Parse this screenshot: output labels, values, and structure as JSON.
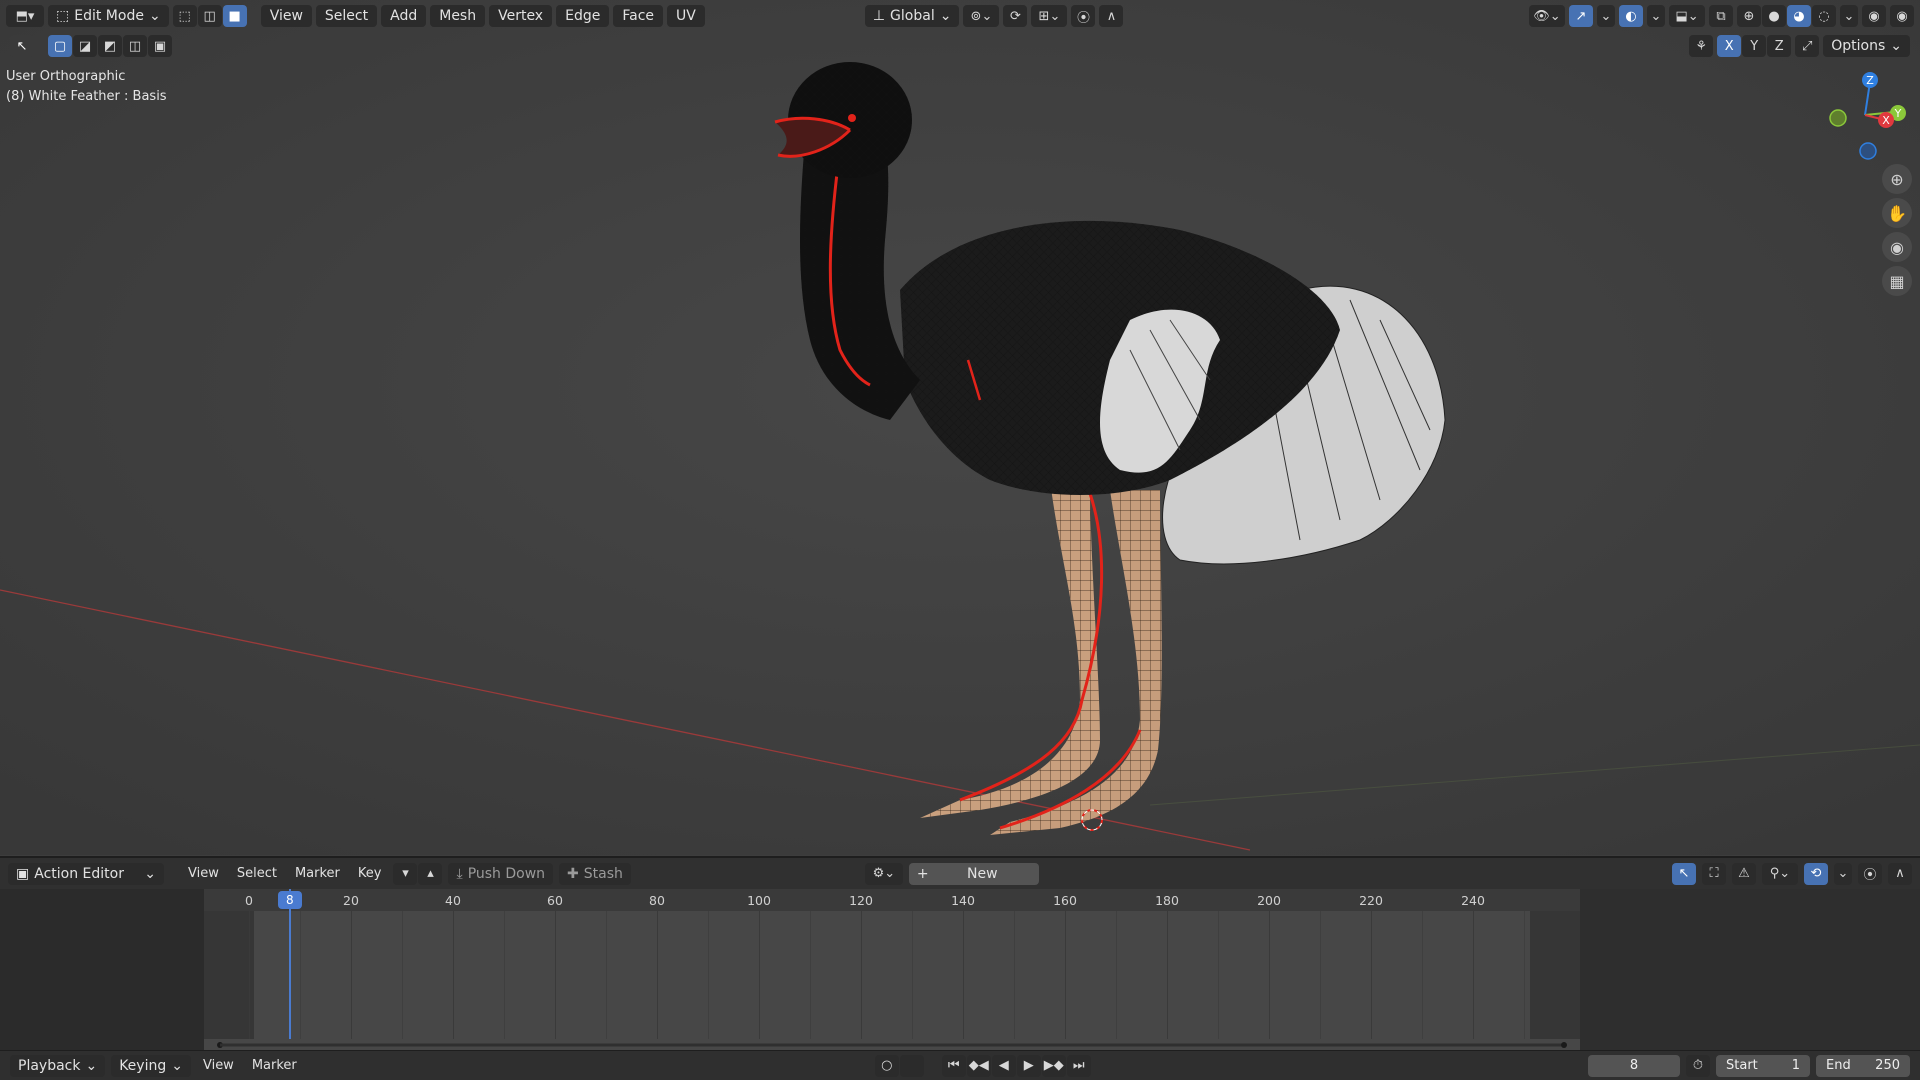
{
  "header": {
    "editor_icon": "3d-viewport-icon",
    "mode": "Edit Mode",
    "menus": [
      "View",
      "Select",
      "Add",
      "Mesh",
      "Vertex",
      "Edge",
      "Face",
      "UV"
    ],
    "orientation": "Global",
    "axes": [
      "X",
      "Y",
      "Z"
    ],
    "options_label": "Options"
  },
  "viewport": {
    "view_name": "User Orthographic",
    "object_info": "(8) White Feather : Basis",
    "gizmo": {
      "z": "Z",
      "y": "Y",
      "x": "X"
    }
  },
  "action_editor": {
    "editor_label": "Action Editor",
    "menus": [
      "View",
      "Select",
      "Marker",
      "Key"
    ],
    "push_down_label": "Push Down",
    "stash_label": "Stash",
    "new_label": "New",
    "ruler_ticks": [
      "0",
      "20",
      "40",
      "60",
      "80",
      "100",
      "120",
      "140",
      "160",
      "180",
      "200",
      "220",
      "240"
    ],
    "current_frame_badge": "8"
  },
  "playback": {
    "playback_label": "Playback",
    "keying_label": "Keying",
    "view_label": "View",
    "marker_label": "Marker",
    "current_frame": "8",
    "start_label": "Start",
    "start_value": "1",
    "end_label": "End",
    "end_value": "250"
  },
  "colors": {
    "accent": "#4772b3",
    "selected_edge": "#d7261a",
    "axis_x": "#e0393e",
    "axis_y": "#8bc83a",
    "axis_z": "#2f7fe0"
  }
}
